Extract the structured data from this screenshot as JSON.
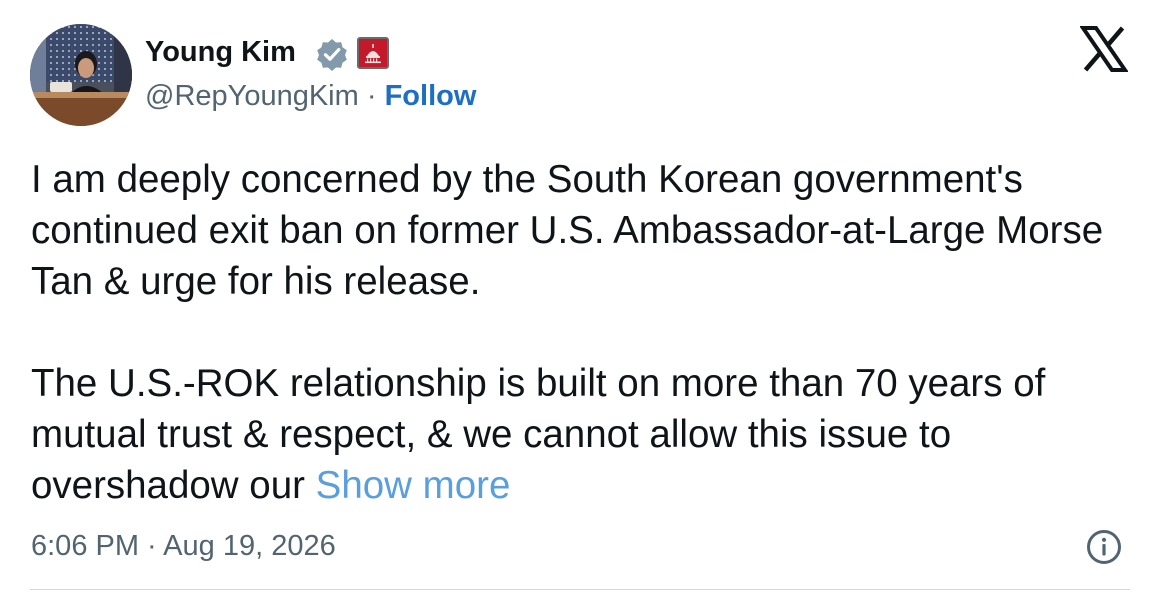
{
  "author": {
    "display_name": "Young Kim",
    "handle": "@RepYoungKim",
    "separator": "·",
    "follow_label": "Follow",
    "avatar_icon": "profile-photo-icon",
    "verified_icon": "verified-badge-icon",
    "affiliation_icon": "government-affiliation-icon"
  },
  "platform": {
    "logo_icon": "x-logo-icon"
  },
  "tweet": {
    "text_para1": "I am deeply concerned by the South Korean government's continued exit ban on former U.S. Ambassador-at-Large Morse Tan & urge for his release.",
    "text_para2": "The U.S.-ROK relationship is built on more than 70 years of mutual trust & respect, & we cannot allow this issue to overshadow our",
    "show_more_label": "Show more",
    "timestamp": "6:06 PM · Aug 19, 2026",
    "info_icon": "info-icon"
  },
  "colors": {
    "text_primary": "#0f1419",
    "text_secondary": "#536471",
    "follow_link": "#1d6fc4",
    "show_more_link": "#5a9fdc",
    "verified_badge": "#829aab",
    "affiliation_badge": "#c4182b"
  }
}
